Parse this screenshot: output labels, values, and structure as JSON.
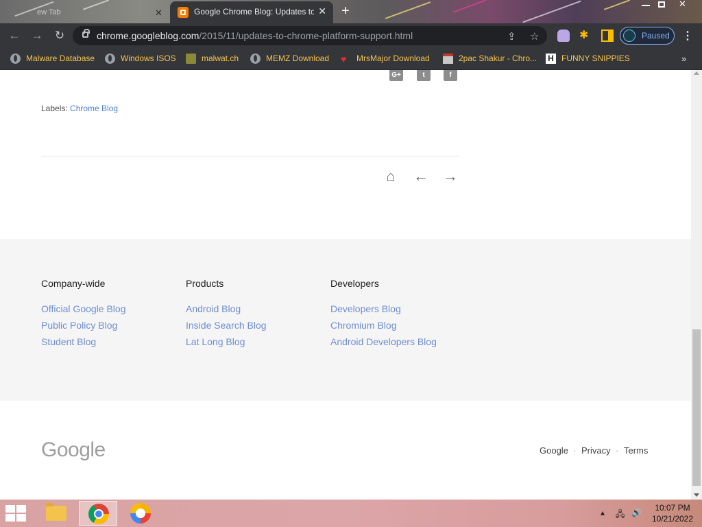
{
  "browser": {
    "tabs": [
      {
        "title": "ew Tab",
        "active": false
      },
      {
        "title": "Google Chrome Blog: Updates to",
        "active": true
      }
    ],
    "url_host": "chrome.googleblog.com",
    "url_path": "/2015/11/updates-to-chrome-platform-support.html",
    "profile_label": "Paused",
    "bookmarks": [
      {
        "label": "Malware Database",
        "icon": "globe-icon"
      },
      {
        "label": "Windows ISOS",
        "icon": "globe-icon"
      },
      {
        "label": "malwat.ch",
        "icon": "site-icon"
      },
      {
        "label": "MEMZ Download",
        "icon": "globe-icon"
      },
      {
        "label": "MrsMajor Download",
        "icon": "heart-icon"
      },
      {
        "label": "2pac Shakur - Chro...",
        "icon": "site-icon"
      },
      {
        "label": "FUNNY SNIPPIES",
        "icon": "h-icon"
      }
    ],
    "bookmarks_more": "»"
  },
  "post": {
    "share_icons": [
      "G+",
      "t",
      "f"
    ],
    "labels_prefix": "Labels:",
    "labels_link": "Chrome Blog"
  },
  "footer": {
    "columns": [
      {
        "heading": "Company-wide",
        "links": [
          "Official Google Blog",
          "Public Policy Blog",
          "Student Blog"
        ]
      },
      {
        "heading": "Products",
        "links": [
          "Android Blog",
          "Inside Search Blog",
          "Lat Long Blog"
        ]
      },
      {
        "heading": "Developers",
        "links": [
          "Developers Blog",
          "Chromium Blog",
          "Android Developers Blog"
        ]
      }
    ],
    "logo": "Google",
    "legal": [
      "Google",
      "Privacy",
      "Terms"
    ],
    "separator": "·"
  },
  "taskbar": {
    "time": "10:07 PM",
    "date": "10/21/2022"
  },
  "colors": {
    "browser_chrome": "#35363a",
    "bookmark_text": "#f6c54b",
    "link_blue": "#6e8ecf",
    "footer_bg": "#f5f5f5"
  }
}
